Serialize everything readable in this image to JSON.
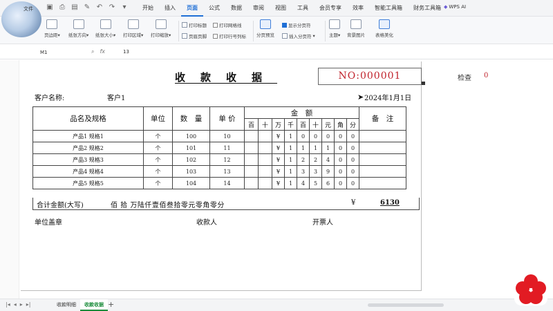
{
  "menubar": {
    "file_label": "文件",
    "tabs": [
      "开始",
      "插入",
      "页面",
      "公式",
      "数据",
      "审阅",
      "视图",
      "工具",
      "会员专享",
      "效率",
      "智能工具箱",
      "财务工具箱"
    ],
    "active_tab": "页面",
    "wps_ai": "WPS AI"
  },
  "ribbon": {
    "margins": "页边距",
    "orientation": "纸张方向",
    "size": "纸张大小",
    "print_area": "打印区域",
    "print_scale": "打印缩放",
    "print_titles": "打印标题",
    "header_footer": "页眉页脚",
    "print_gridlines": "打印网格线",
    "print_headings": "打印行号列标",
    "page_break_preview": "分页预览",
    "show_page_breaks": "显示分页符",
    "insert_page_break": "插入分页符",
    "theme": "主题",
    "background": "背景图片",
    "table_beautify": "表格美化"
  },
  "formula_bar": {
    "cell_ref": "M1",
    "value": "13"
  },
  "receipt": {
    "title": "收款收据",
    "number": "NO:000001",
    "check_label": "检查",
    "check_value": "0",
    "customer_label": "客户名称:",
    "customer_value": "客户1",
    "date": "2024年1月1日",
    "headers": {
      "name": "品名及规格",
      "unit": "单位",
      "qty": "数　量",
      "price": "单 价",
      "amount": "金　额",
      "note": "备　注",
      "digits": [
        "百",
        "十",
        "万",
        "千",
        "百",
        "十",
        "元",
        "角",
        "分"
      ]
    },
    "rows": [
      {
        "name": "产品1 规格1",
        "unit": "个",
        "qty": "100",
        "price": "10",
        "digits": [
          "",
          "",
          "¥",
          "1",
          "0",
          "0",
          "0",
          "0",
          "0"
        ],
        "note": ""
      },
      {
        "name": "产品2 规格2",
        "unit": "个",
        "qty": "101",
        "price": "11",
        "digits": [
          "",
          "",
          "¥",
          "1",
          "1",
          "1",
          "1",
          "0",
          "0"
        ],
        "note": ""
      },
      {
        "name": "产品3 规格3",
        "unit": "个",
        "qty": "102",
        "price": "12",
        "digits": [
          "",
          "",
          "¥",
          "1",
          "2",
          "2",
          "4",
          "0",
          "0"
        ],
        "note": ""
      },
      {
        "name": "产品4 规格4",
        "unit": "个",
        "qty": "103",
        "price": "13",
        "digits": [
          "",
          "",
          "¥",
          "1",
          "3",
          "3",
          "9",
          "0",
          "0"
        ],
        "note": ""
      },
      {
        "name": "产品5 规格5",
        "unit": "个",
        "qty": "104",
        "price": "14",
        "digits": [
          "",
          "",
          "¥",
          "1",
          "4",
          "5",
          "6",
          "0",
          "0"
        ],
        "note": ""
      }
    ],
    "total_label": "合计金额(大写)",
    "total_words": "佰 拾 万陆仟壹佰叁拾零元零角零分",
    "total_currency": "¥",
    "total_number": "6130",
    "sign_unit": "单位盖章",
    "sign_payee": "收款人",
    "sign_issuer": "开票人"
  },
  "sheet_tabs": [
    "收款明细",
    "收款收据"
  ],
  "active_sheet": "收款收据",
  "colors": {
    "accent": "#1f6fd6",
    "number_red": "#c0232c",
    "sheet_green": "#1a8c3a",
    "flower_red": "#e21b23"
  }
}
